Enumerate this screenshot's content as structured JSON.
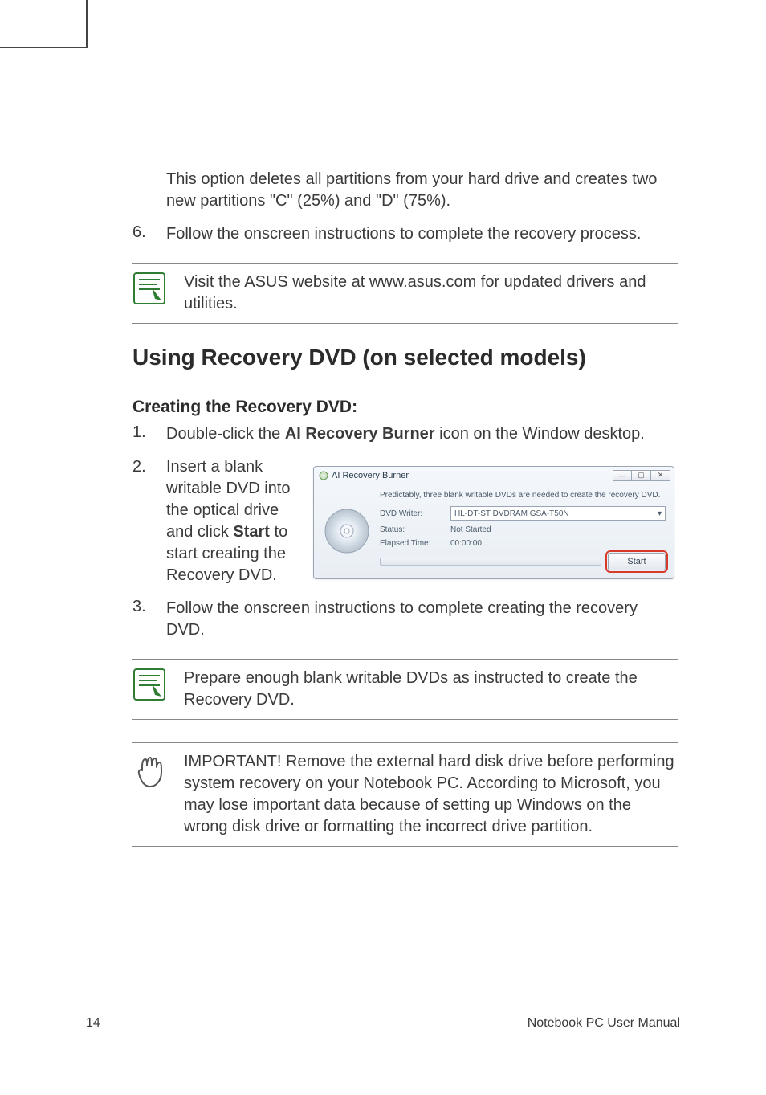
{
  "para_partitions": "This option deletes all partitions from your hard drive and creates two new partitions \"C\" (25%) and \"D\" (75%).",
  "step6_num": "6.",
  "step6_text": "Follow the onscreen instructions to complete the recovery process.",
  "note_visit": "Visit the ASUS website at www.asus.com for updated drivers and utilities.",
  "section_title": "Using Recovery DVD (on selected models)",
  "subsection_title": "Creating the Recovery DVD:",
  "step1_num": "1.",
  "step1_pre": "Double-click the ",
  "step1_bold": "AI Recovery Burner",
  "step1_post": " icon on the Window desktop.",
  "step2_num": "2.",
  "step2_pre": "Insert a blank writable DVD into the optical drive and click ",
  "step2_bold": "Start",
  "step2_post": " to start creating the Recovery DVD.",
  "step3_num": "3.",
  "step3_text": "Follow the onscreen instructions to complete creating the recovery DVD.",
  "note_prepare": "Prepare enough blank writable DVDs as instructed to create the Recovery DVD.",
  "note_important": "IMPORTANT! Remove the external hard disk drive before performing system recovery on your Notebook PC. According to Microsoft, you may lose important data because of setting up Windows on the wrong disk drive or formatting the incorrect drive partition.",
  "footer_page": "14",
  "footer_title": "Notebook PC User Manual",
  "rb": {
    "title": "AI Recovery Burner",
    "min": "—",
    "max": "▢",
    "close": "✕",
    "prediction": "Predictably, three blank writable DVDs are needed to create the recovery DVD.",
    "writer_label": "DVD Writer:",
    "writer_value": "HL-DT-ST DVDRAM GSA-T50N",
    "status_label": "Status:",
    "status_value": "Not Started",
    "elapsed_label": "Elapsed Time:",
    "elapsed_value": "00:00:00",
    "start_label": "Start",
    "dropdown_arrow": "▾"
  }
}
